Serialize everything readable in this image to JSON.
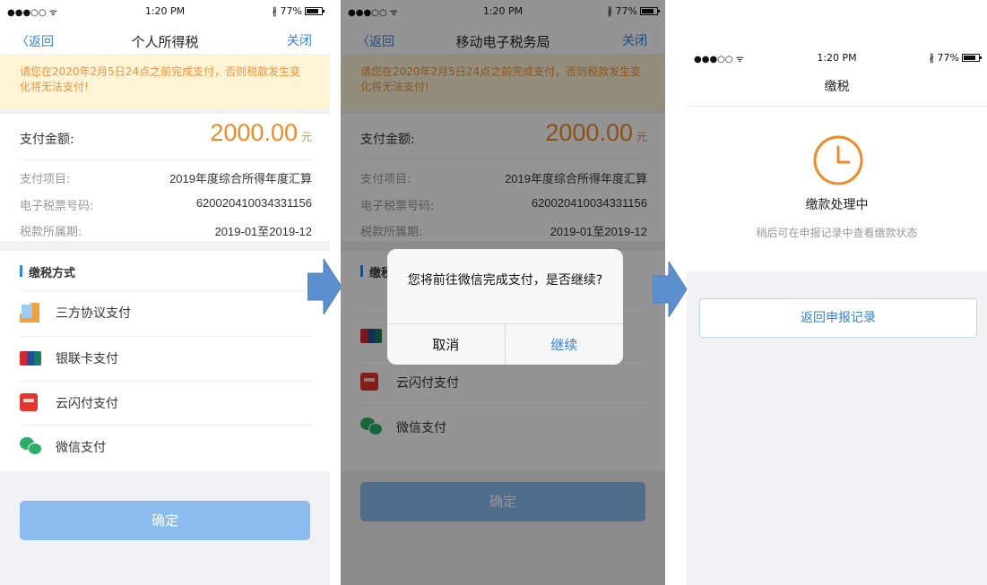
{
  "status_bar": {
    "signal": "●●●○○ ᯤ",
    "time": "1:20 PM",
    "battery": "∦ 77%"
  },
  "screen1": {
    "nav": {
      "back": "〈返回",
      "title": "个人所得税",
      "close": "关闭"
    },
    "notice": "请您在2020年2月5日24点之前完成支付，否则税款发生变化将无法支付!",
    "amount": {
      "label": "支付金额:",
      "value": "2000.00",
      "unit": "元"
    },
    "details": [
      {
        "key": "支付项目:",
        "value": "2019年度综合所得年度汇算"
      },
      {
        "key": "电子税票号码:",
        "value": "620020410034331156"
      },
      {
        "key": "税款所属期:",
        "value": "2019-01至2019-12"
      }
    ],
    "method_header": "缴税方式",
    "methods": [
      {
        "label": "三方协议支付",
        "icon": "pen-icon"
      },
      {
        "label": "银联卡支付",
        "icon": "unionpay-icon"
      },
      {
        "label": "云闪付支付",
        "icon": "quickpass-icon"
      },
      {
        "label": "微信支付",
        "icon": "wechat-icon"
      }
    ],
    "confirm": "确定"
  },
  "screen2": {
    "nav": {
      "back": "〈返回",
      "title": "移动电子税务局",
      "close": "关闭"
    },
    "notice": "请您在2020年2月5日24点之前完成支付，否则税款发生变化将无法支付!",
    "amount": {
      "label": "支付金额:",
      "value": "2000.00",
      "unit": "元"
    },
    "details": [
      {
        "key": "支付项目:",
        "value": "2019年度综合所得年度汇算"
      },
      {
        "key": "电子税票号码:",
        "value": "620020410034331156"
      },
      {
        "key": "税款所属期:",
        "value": "2019-01至2019-12"
      }
    ],
    "method_header": "缴税",
    "methods": [
      {
        "label": "",
        "icon": "unionpay-icon"
      },
      {
        "label": "云闪付支付",
        "icon": "quickpass-icon"
      },
      {
        "label": "微信支付",
        "icon": "wechat-icon"
      }
    ],
    "confirm": "确定",
    "dialog": {
      "message": "您将前往微信完成支付，是否继续?",
      "cancel": "取消",
      "ok": "继续"
    }
  },
  "screen3": {
    "title": "缴税",
    "status": "缴款处理中",
    "hint": "稍后可在申报记录中查看缴款状态",
    "button": "返回申报记录"
  },
  "colors": {
    "accent": "#2f83e4",
    "amount": "#f08a24",
    "arrow": "#5b8fd0",
    "clock": "#f08a24"
  }
}
